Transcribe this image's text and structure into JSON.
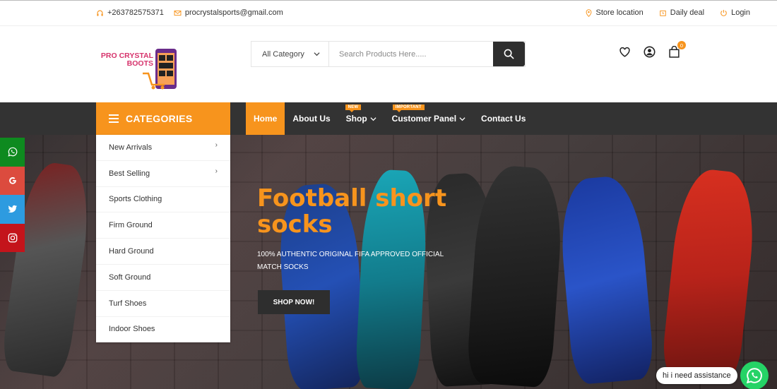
{
  "topbar": {
    "phone": "+263782575371",
    "email": "procrystalsports@gmail.com",
    "store_location": "Store location",
    "daily_deal": "Daily deal",
    "login": "Login"
  },
  "logo": {
    "line1": "PRO CRYSTAL",
    "line2": "BOOTS"
  },
  "search": {
    "category": "All Category",
    "placeholder": "Search Products Here....."
  },
  "cart": {
    "count": "0"
  },
  "categories_title": "CATEGORIES",
  "nav": {
    "home": "Home",
    "about": "About Us",
    "shop": "Shop",
    "shop_badge": "NEW",
    "customer_panel": "Customer Panel",
    "customer_badge": "IMPORTANT",
    "contact": "Contact Us"
  },
  "category_items": [
    {
      "label": "New Arrivals"
    },
    {
      "label": "Best Selling"
    },
    {
      "label": "Sports Clothing"
    },
    {
      "label": "Firm Ground"
    },
    {
      "label": "Hard Ground"
    },
    {
      "label": "Soft Ground"
    },
    {
      "label": "Turf Shoes"
    },
    {
      "label": "Indoor Shoes"
    }
  ],
  "hero": {
    "title": "Football short socks",
    "subtitle": "100% AUTHENTIC ORIGINAL FIFA APPROVED OFFICIAL MATCH SOCKS",
    "button": "SHOP NOW!"
  },
  "social_colors": {
    "whatsapp": "#0e8a1f",
    "google": "#dc4b3e",
    "twitter": "#2d9be0",
    "instagram": "#c4141b"
  },
  "accent_color": "#f7941d",
  "chat": {
    "message": "hi i need assistance"
  }
}
